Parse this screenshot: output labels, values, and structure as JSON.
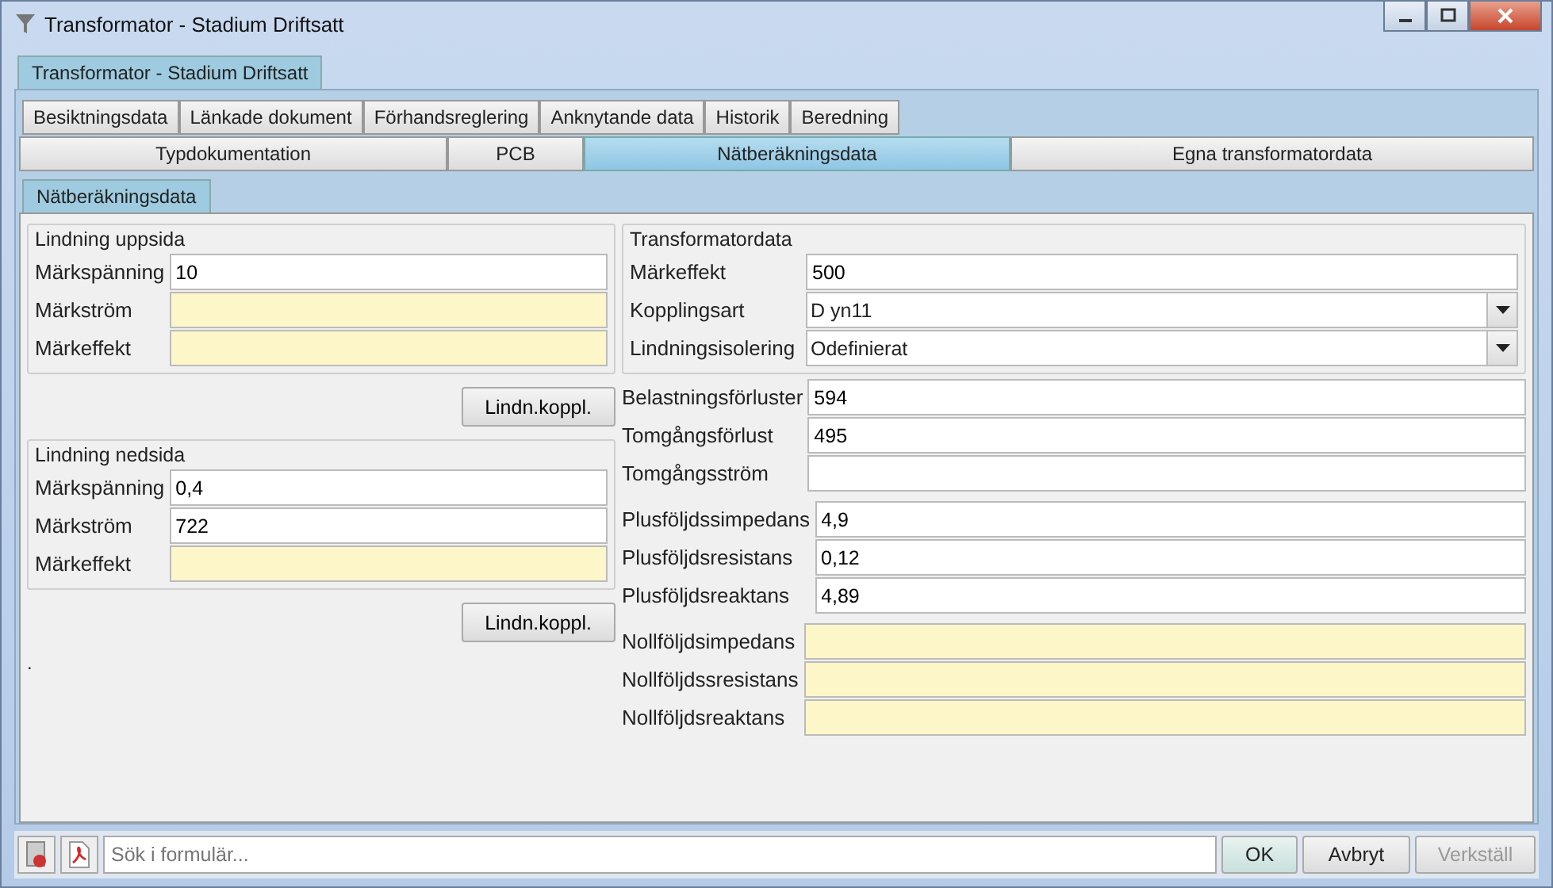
{
  "window": {
    "title": "Transformator - Stadium Driftsatt"
  },
  "document_tabs": [
    {
      "label": "Transformator - Stadium Driftsatt",
      "selected": true
    }
  ],
  "tab_rows": [
    [
      {
        "label": "Besiktningsdata",
        "selected": false
      },
      {
        "label": "Länkade dokument",
        "selected": false
      },
      {
        "label": "Förhandsreglering",
        "selected": false
      },
      {
        "label": "Anknytande data",
        "selected": false
      },
      {
        "label": "Historik",
        "selected": false
      },
      {
        "label": "Beredning",
        "selected": false
      }
    ],
    [
      {
        "label": "Typdokumentation",
        "selected": false
      },
      {
        "label": "PCB",
        "selected": false
      },
      {
        "label": "Nätberäkningsdata",
        "selected": true
      },
      {
        "label": "Egna transformatordata",
        "selected": false
      }
    ]
  ],
  "sub_tabs": [
    {
      "label": "Nätberäkningsdata",
      "selected": true
    }
  ],
  "left_groups": [
    {
      "title": "Lindning uppsida",
      "fields": [
        {
          "label": "Märkspänning",
          "value": "10",
          "required": false
        },
        {
          "label": "Märkström",
          "required": true
        },
        {
          "label": "Märkeffekt",
          "required": true
        }
      ],
      "button": "Lindn.koppl."
    },
    {
      "title": "Lindning nedsida",
      "fields": [
        {
          "label": "Märkspänning",
          "value": "0,4",
          "required": false
        },
        {
          "label": "Märkström",
          "value": "722",
          "required": false
        },
        {
          "label": "Märkeffekt",
          "required": true
        }
      ],
      "button": "Lindn.koppl."
    }
  ],
  "left_note": ".",
  "right_groups": [
    {
      "title": "Transformatordata",
      "fields": [
        {
          "label": "Märkeffekt",
          "value": "500",
          "required": false,
          "kind": "text"
        },
        {
          "label": "Kopplingsart",
          "value": "D yn11",
          "required": false,
          "kind": "dropdown"
        },
        {
          "label": "Lindningsisolering",
          "value": "Odefinierat",
          "required": false,
          "kind": "dropdown"
        }
      ]
    },
    {
      "fields": [
        {
          "label": "Belastningsförluster",
          "value": "594",
          "required": false,
          "kind": "text"
        },
        {
          "label": "Tomgångsförlust",
          "value": "495",
          "required": false,
          "kind": "text"
        },
        {
          "label": "Tomgångsström",
          "required": false,
          "kind": "text"
        }
      ]
    },
    {
      "fields": [
        {
          "label": "Plusföljdssimpedans",
          "value": "4,9",
          "required": false,
          "kind": "text"
        },
        {
          "label": "Plusföljdsresistans",
          "value": "0,12",
          "required": false,
          "kind": "text"
        },
        {
          "label": "Plusföljdsreaktans",
          "value": "4,89",
          "required": false,
          "kind": "text"
        }
      ]
    },
    {
      "fields": [
        {
          "label": "Nollföljdsimpedans",
          "required": true,
          "kind": "text"
        },
        {
          "label": "Nollföljdssresistans",
          "required": true,
          "kind": "text"
        },
        {
          "label": "Nollföljdsreaktans",
          "required": true,
          "kind": "text"
        }
      ]
    }
  ],
  "bottom_bar": {
    "search": {
      "placeholder": "Sök i formulär..."
    },
    "buttons": [
      {
        "label": "OK",
        "disabled": false
      },
      {
        "label": "Avbryt",
        "disabled": false
      },
      {
        "label": "Verkställ",
        "disabled": true
      }
    ]
  }
}
